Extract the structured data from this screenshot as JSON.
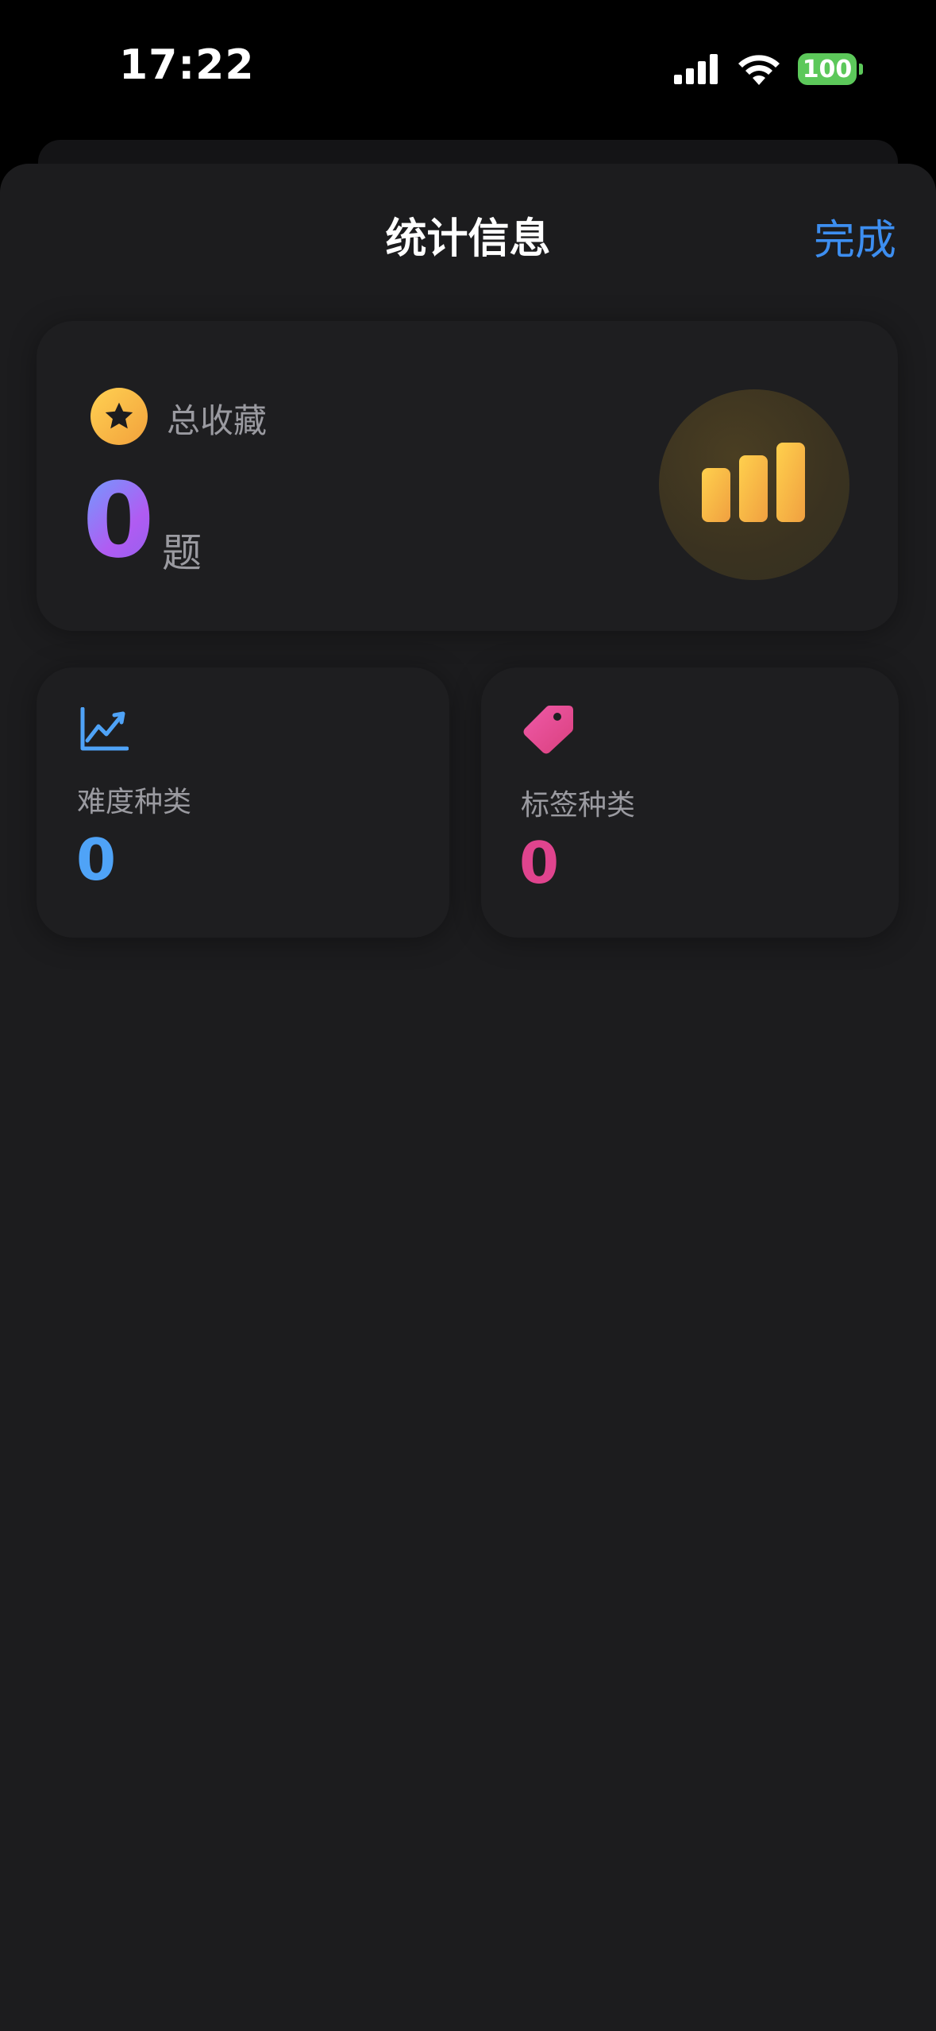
{
  "status_bar": {
    "time": "17:22",
    "battery": "100"
  },
  "nav": {
    "title": "统计信息",
    "done_label": "完成"
  },
  "summary": {
    "label": "总收藏",
    "count": "0",
    "unit": "题"
  },
  "stats": [
    {
      "label": "难度种类",
      "value": "0",
      "color": "#4fa3f7",
      "icon": "chart-line-icon"
    },
    {
      "label": "标签种类",
      "value": "0",
      "color": "#e0448e",
      "icon": "tag-icon"
    }
  ],
  "colors": {
    "accent": "#3d8ef0",
    "background": "#1c1c1e",
    "star": "#f5b844",
    "bars": "#f6b744"
  }
}
